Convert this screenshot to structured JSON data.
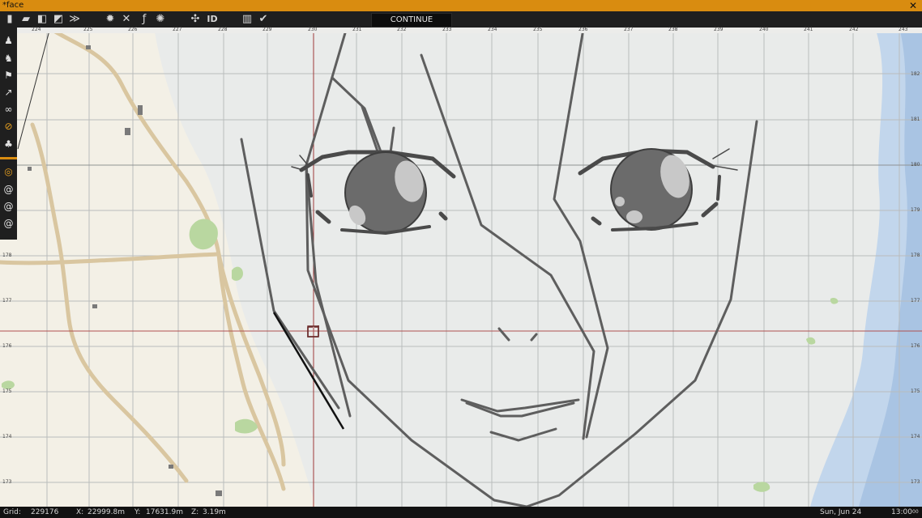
{
  "window": {
    "title": "*face",
    "close_glyph": "✕"
  },
  "toolbar": {
    "continue_label": "CONTINUE",
    "icons": [
      "new-file-icon",
      "open-folder-icon",
      "save-icon",
      "save-as-icon",
      "export-icon",
      "settings-gear-icon",
      "tools-icon",
      "function-icon",
      "config-gear-icon",
      "expand-icon",
      "id-icon",
      "panel-icon",
      "check-icon"
    ]
  },
  "ruler": {
    "top_labels": [
      "224",
      "225",
      "226",
      "227",
      "228",
      "229",
      "230",
      "231",
      "232",
      "233",
      "234",
      "235",
      "236",
      "237",
      "238",
      "239",
      "240",
      "241",
      "242",
      "243"
    ],
    "right_labels": [
      "182",
      "181",
      "180",
      "179",
      "178",
      "177",
      "176",
      "175",
      "174",
      "173"
    ],
    "left_labels": [
      "178",
      "177",
      "176",
      "175",
      "174",
      "173"
    ]
  },
  "status": {
    "grid_label": "Grid:",
    "grid_value": "229176",
    "x_label": "X:",
    "x_value": "22999.8m",
    "y_label": "Y:",
    "y_value": "17631.9m",
    "z_label": "Z:",
    "z_value": "3.19m",
    "date": "Sun, Jun 24",
    "time": "13:00",
    "time_seconds": "00"
  },
  "colors": {
    "accent": "#d98c10",
    "toolbar": "#1f1f1f",
    "map_bg": "#e9ebea",
    "road": "#d8c29a",
    "water": "#b9d1ea"
  }
}
